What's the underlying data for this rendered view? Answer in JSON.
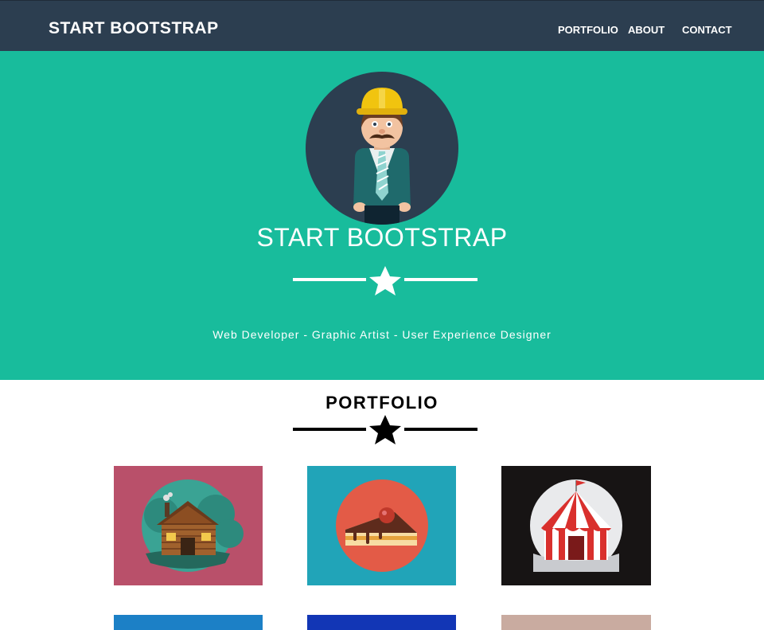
{
  "navbar": {
    "brand": "START BOOTSTRAP",
    "links": [
      {
        "label": "PORTFOLIO"
      },
      {
        "label": "ABOUT"
      },
      {
        "label": "CONTACT"
      }
    ]
  },
  "hero": {
    "title": "START BOOTSTRAP",
    "subtitle": "Web Developer - Graphic Artist - User Experience Designer",
    "avatar_icon": "construction-worker-avatar",
    "divider_icon": "star-icon"
  },
  "portfolio": {
    "title": "PORTFOLIO",
    "divider_icon": "star-icon",
    "items": [
      {
        "icon": "log-cabin-icon",
        "bg": "#b9506a"
      },
      {
        "icon": "cake-slice-icon",
        "bg": "#21a4b8"
      },
      {
        "icon": "circus-tent-icon",
        "bg": "#171414"
      },
      {
        "icon": "portfolio-item-4",
        "bg": "#1c80c6"
      },
      {
        "icon": "portfolio-item-5",
        "bg": "#1236b5"
      },
      {
        "icon": "portfolio-item-6",
        "bg": "#c9aba0"
      }
    ]
  },
  "colors": {
    "navbar": "#2c3e50",
    "hero": "#18bc9c",
    "white": "#ffffff"
  }
}
